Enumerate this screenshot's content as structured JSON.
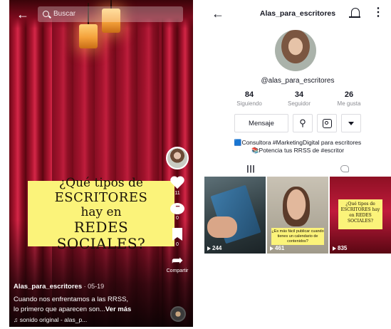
{
  "video": {
    "search_placeholder": "Buscar",
    "caption": {
      "line1": "¿Qué tipos de",
      "line2": "ESCRITORES",
      "line3": "hay en",
      "line4": "REDES SOCIALES?"
    },
    "rail": {
      "likes": "11",
      "comments": "0",
      "saves": "0",
      "share_label": "Compartir"
    },
    "author": "Alas_para_escritores",
    "date": " · 05-19",
    "description_line1": "Cuando nos enfrentamos a las RRSS,",
    "description_line2": "lo primero que aparecen son...",
    "more_label": "Ver más",
    "sound": "sonido original - alas_p..."
  },
  "profile": {
    "title": "Alas_para_escritores",
    "handle": "@alas_para_escritores",
    "stats": [
      {
        "value": "84",
        "label": "Siguiendo"
      },
      {
        "value": "34",
        "label": "Seguidor"
      },
      {
        "value": "26",
        "label": "Me gusta"
      }
    ],
    "message_button": "Mensaje",
    "bio_line1": "Consultora #MarketingDigital para escritores",
    "bio_line2": "Potencia tus RRSS de #escritor",
    "bio_icon1": "🟦",
    "bio_icon2": "📚",
    "videos": [
      {
        "views": "244"
      },
      {
        "views": "461",
        "caption": "¿Es más fácil publicar cuando tienes un calendario de contenidos?"
      },
      {
        "views": "835",
        "caption": "¿Qué tipos de ESCRITORES hay en REDES SOCIALES?"
      }
    ]
  }
}
